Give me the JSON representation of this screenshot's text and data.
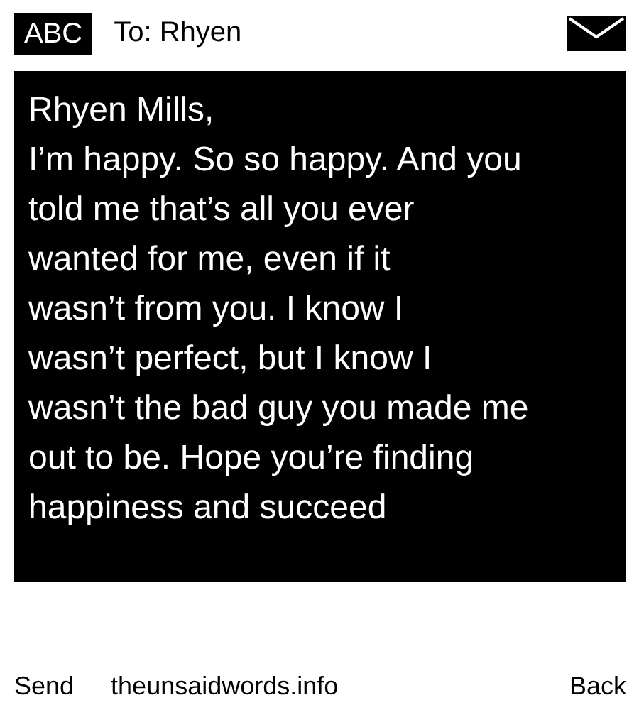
{
  "header": {
    "badge": "ABC",
    "recipient": "To: Rhyen"
  },
  "message": {
    "text": "Rhyen Mills,\nI’m happy. So so happy. And you\ntold me that’s all you ever\nwanted for me, even if it\nwasn’t from you. I know I\nwasn’t perfect, but I know I\nwasn’t the bad guy you made me\nout to be. Hope you’re finding\nhappiness and succeed"
  },
  "footer": {
    "send": "Send",
    "site": "theunsaidwords.info",
    "back": "Back"
  }
}
